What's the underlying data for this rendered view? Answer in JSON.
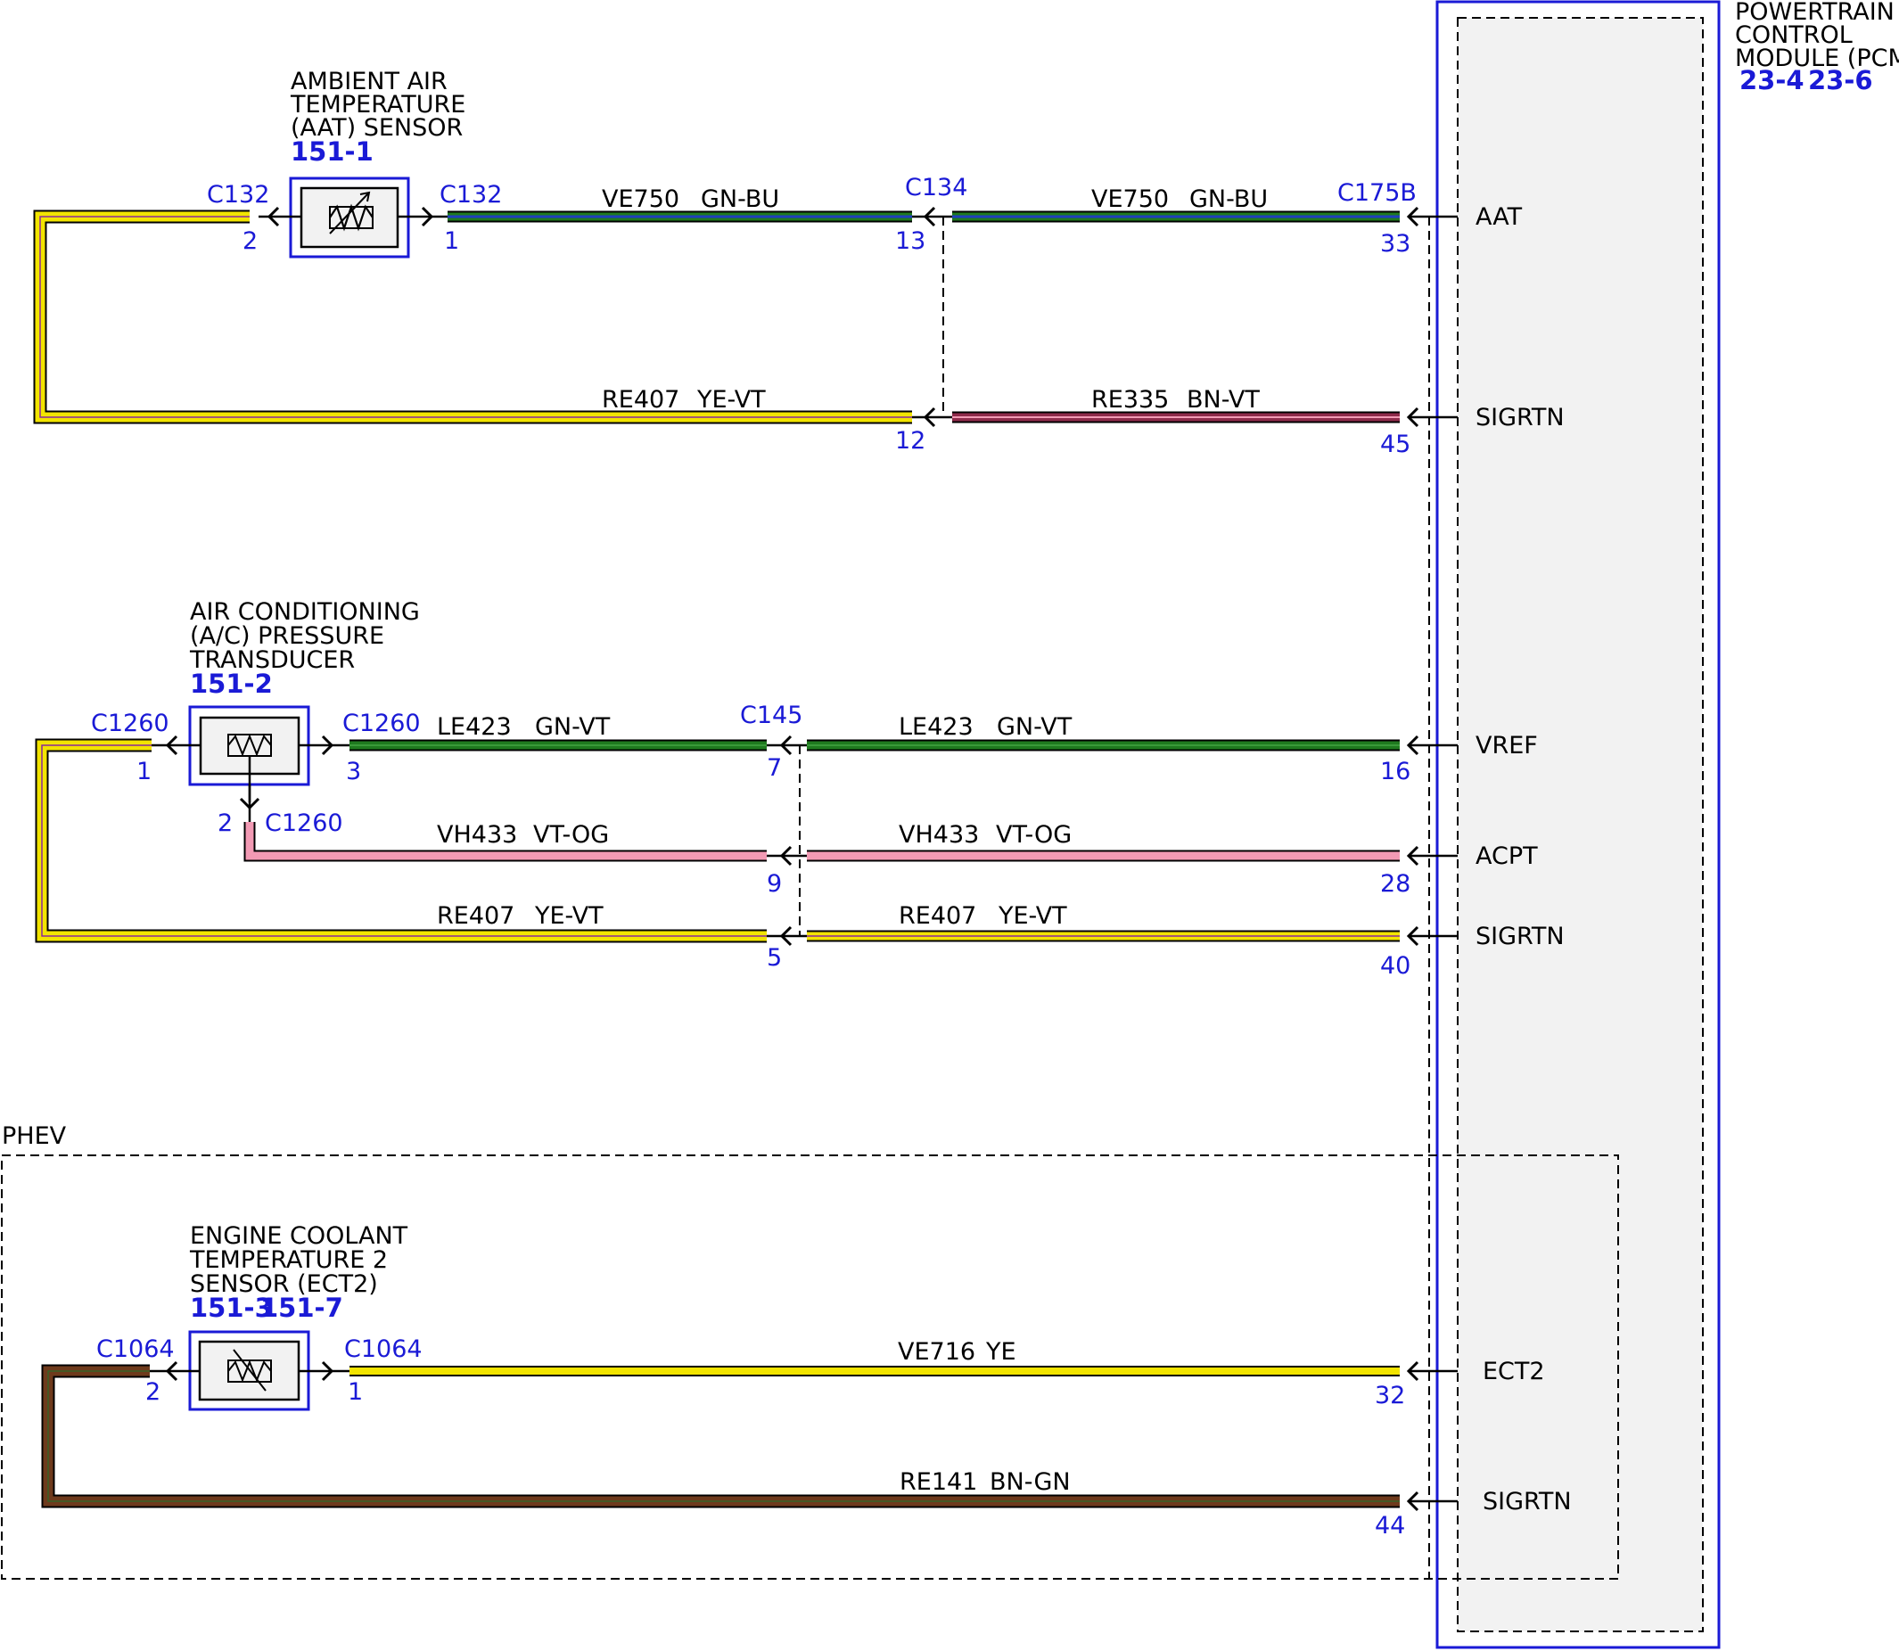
{
  "colors": {
    "frame_blue": "#1a1ad6",
    "yellow": "#f2e400",
    "green": "#1f7a1f",
    "blue": "#1f3fbf",
    "brown": "#6e3a1c",
    "pink": "#f29ab4",
    "violet": "#8a2a9a",
    "module_fill": "#f2f2f2"
  },
  "pcm": {
    "title_lines": [
      "POWERTRAIN",
      "CONTROL",
      "MODULE (PCM)"
    ],
    "refs": [
      "23-4",
      "23-6"
    ],
    "connector": "C175B",
    "pins": [
      {
        "signal": "AAT",
        "number": "33"
      },
      {
        "signal": "SIGRTN",
        "number": "45"
      },
      {
        "signal": "VREF",
        "number": "16"
      },
      {
        "signal": "ACPT",
        "number": "28"
      },
      {
        "signal": "SIGRTN",
        "number": "40"
      },
      {
        "signal": "ECT2",
        "number": "32"
      },
      {
        "signal": "SIGRTN",
        "number": "44"
      }
    ]
  },
  "aat": {
    "title_lines": [
      "AMBIENT AIR",
      "TEMPERATURE",
      "(AAT) SENSOR"
    ],
    "ref": "151-1",
    "conn_left": "C132",
    "pin_left": "2",
    "conn_right": "C132",
    "pin_right": "1",
    "inline": {
      "name": "C134",
      "pin_top": "13",
      "pin_bottom": "12"
    },
    "wires": [
      {
        "circuit": "VE750",
        "color": "GN-BU"
      },
      {
        "circuit": "VE750",
        "color": "GN-BU"
      },
      {
        "circuit": "RE407",
        "color": "YE-VT"
      },
      {
        "circuit": "RE335",
        "color": "BN-VT"
      }
    ]
  },
  "acpt": {
    "title_lines": [
      "AIR CONDITIONING",
      "(A/C) PRESSURE",
      "TRANSDUCER"
    ],
    "ref": "151-2",
    "conn_left": "C1260",
    "pin_left": "1",
    "conn_right": "C1260",
    "pin_right": "3",
    "conn_bottom": "C1260",
    "pin_bottom": "2",
    "inline": {
      "name": "C145",
      "pin_a": "7",
      "pin_b": "9",
      "pin_c": "5"
    },
    "wires": [
      {
        "circuit": "LE423",
        "color": "GN-VT"
      },
      {
        "circuit": "LE423",
        "color": "GN-VT"
      },
      {
        "circuit": "VH433",
        "color": "VT-OG"
      },
      {
        "circuit": "VH433",
        "color": "VT-OG"
      },
      {
        "circuit": "RE407",
        "color": "YE-VT"
      },
      {
        "circuit": "RE407",
        "color": "YE-VT"
      }
    ]
  },
  "ect2": {
    "option_label": "PHEV",
    "title_lines": [
      "ENGINE COOLANT",
      "TEMPERATURE 2",
      "SENSOR (ECT2)"
    ],
    "refs": [
      "151-3",
      "151-7"
    ],
    "conn_left": "C1064",
    "pin_left": "2",
    "conn_right": "C1064",
    "pin_right": "1",
    "wires": [
      {
        "circuit": "VE716",
        "color": "YE"
      },
      {
        "circuit": "RE141",
        "color": "BN-GN"
      }
    ]
  }
}
